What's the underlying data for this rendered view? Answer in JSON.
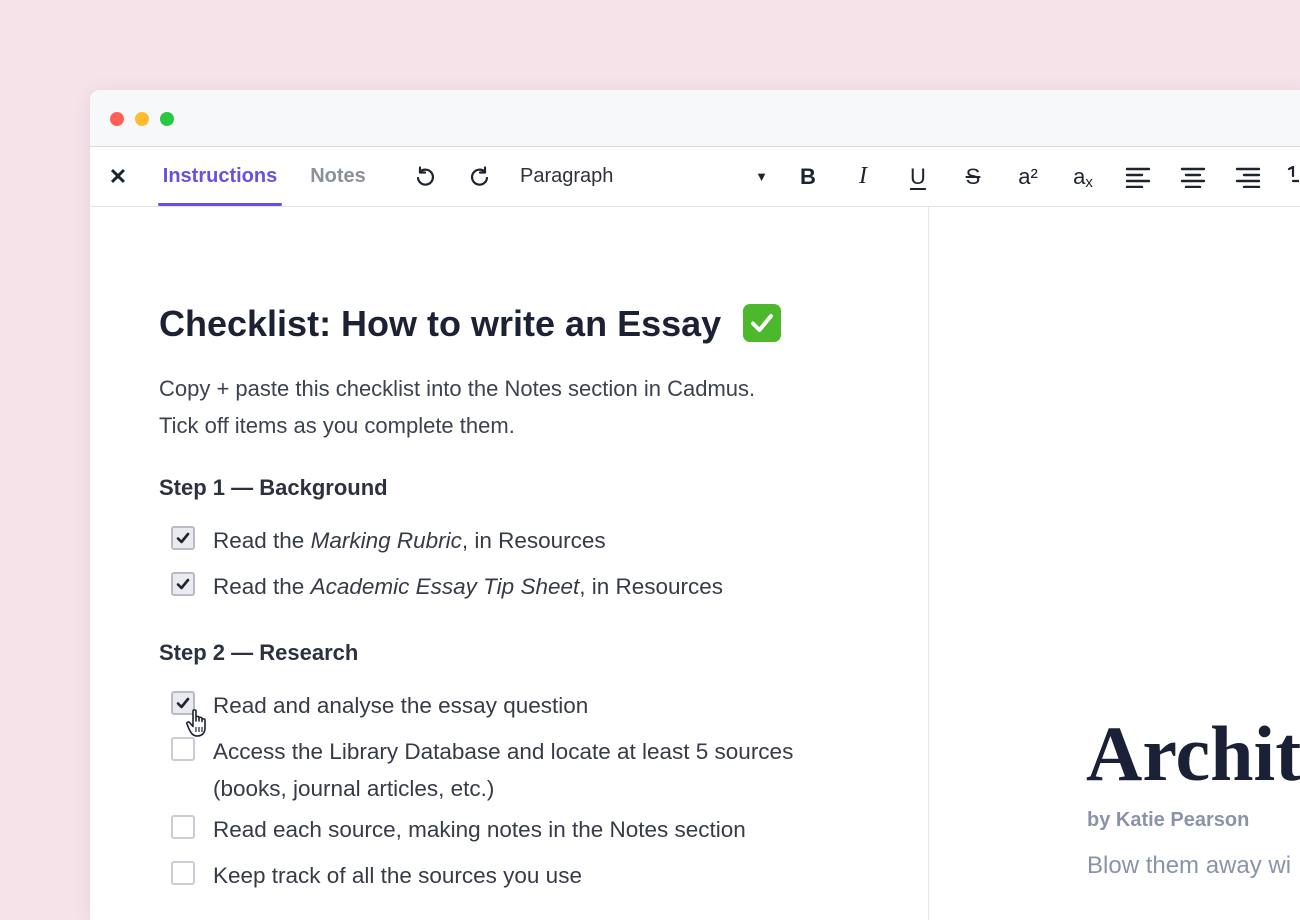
{
  "toolbar": {
    "close_label": "✕",
    "tabs": [
      {
        "label": "Instructions",
        "active": true
      },
      {
        "label": "Notes",
        "active": false
      }
    ],
    "block_style": "Paragraph",
    "format_buttons": {
      "bold": "B",
      "italic": "I",
      "underline": "U",
      "strikethrough": "S",
      "superscript": "a²",
      "subscript_base": "a",
      "subscript_x": "x"
    }
  },
  "document": {
    "title": "Checklist: How to write an Essay",
    "intro_line1": "Copy + paste this checklist into the Notes section in Cadmus.",
    "intro_line2": "Tick off items as you complete them.",
    "steps": [
      {
        "heading": "Step 1 — Background",
        "items": [
          {
            "checked": true,
            "pre": "Read the ",
            "em": "Marking Rubric",
            "post": ", in Resources"
          },
          {
            "checked": true,
            "pre": "Read the ",
            "em": "Academic Essay Tip Sheet",
            "post": ", in Resources"
          }
        ]
      },
      {
        "heading": "Step 2 — Research",
        "items": [
          {
            "checked": true,
            "text": "Read and analyse the essay question"
          },
          {
            "checked": false,
            "text": "Access the Library Database and locate at least 5 sources",
            "text2": "(books, journal articles, etc.)"
          },
          {
            "checked": false,
            "text": "Read each source, making notes in the Notes section"
          },
          {
            "checked": false,
            "text": "Keep track of all the sources you use"
          }
        ]
      }
    ]
  },
  "preview": {
    "title": "Archite",
    "author": "by Katie Pearson",
    "subtitle": "Blow them away wi"
  },
  "colors": {
    "accent": "#6a4fe0",
    "background": "#f6e3ea",
    "checkmark_green": "#4cb82b"
  }
}
